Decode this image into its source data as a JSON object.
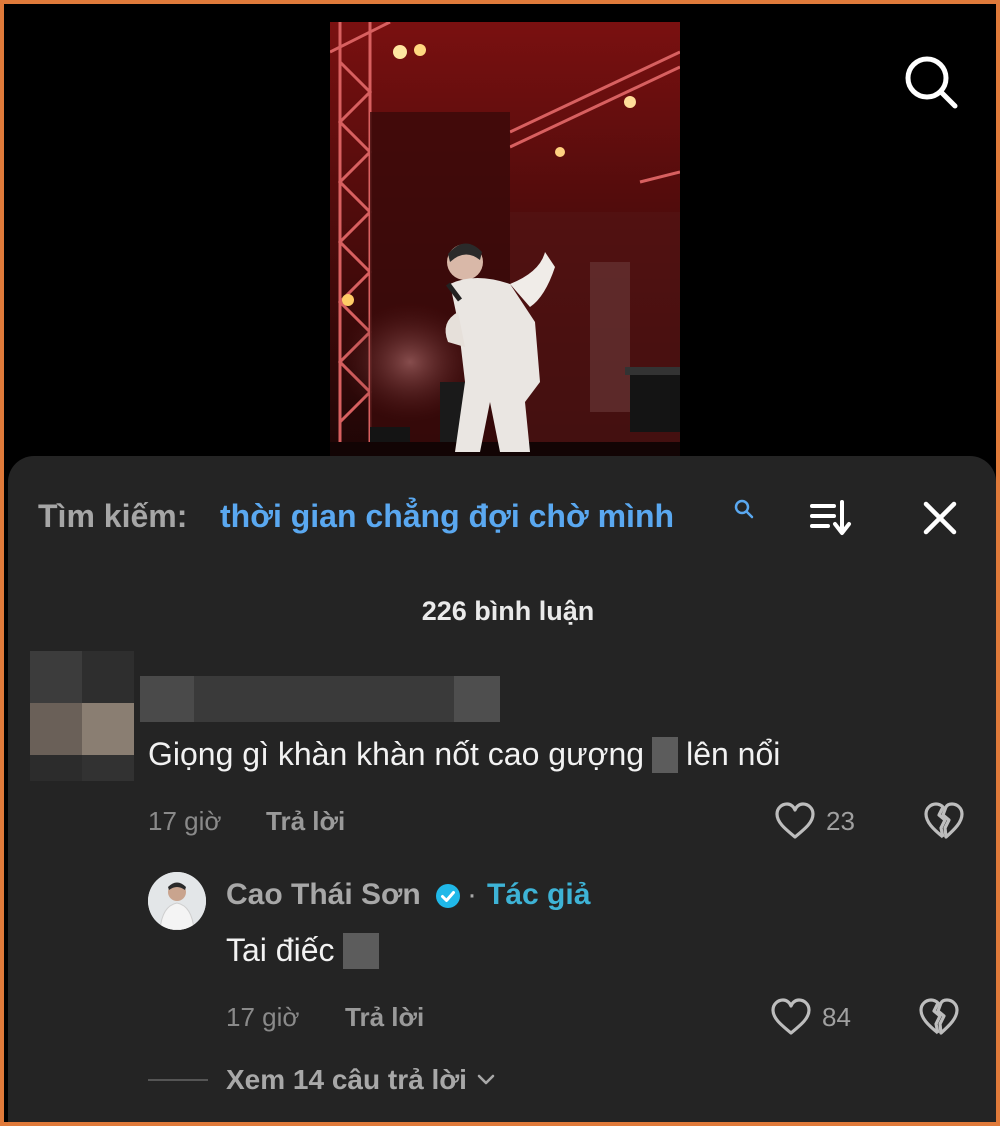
{
  "search_bar": {
    "prefix": "Tìm kiếm:",
    "query": "thời gian chẳng đợi chờ mình"
  },
  "comment_count_label": "226 bình luận",
  "comments": [
    {
      "author": "",
      "text_before": "Giọng gì khàn khàn nốt cao gượng",
      "text_after": "lên nổi",
      "time": "17 giờ",
      "reply_label": "Trả lời",
      "likes": "23"
    }
  ],
  "reply": {
    "author": "Cao Thái Sơn",
    "separator": "·",
    "badge": "Tác giả",
    "text": "Tai điếc",
    "time": "17 giờ",
    "reply_label": "Trả lời",
    "likes": "84"
  },
  "view_replies_label": "Xem 14 câu trả lời",
  "colors": {
    "accent_blue": "#5aa8f0",
    "author_badge": "#3eb3d6",
    "sheet_bg": "#242424",
    "frame_border": "#e07a3a"
  },
  "icons": [
    "search-icon",
    "sort-icon",
    "close-icon",
    "heart-icon",
    "broken-heart-icon",
    "verified-icon",
    "chevron-down-icon"
  ]
}
